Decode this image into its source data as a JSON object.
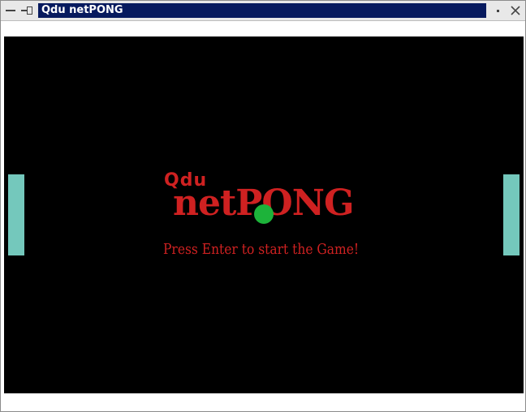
{
  "window": {
    "title": "Qdu netPONG"
  },
  "game": {
    "logo_small": "Qdu",
    "logo_big": "netPONG",
    "prompt": "Press Enter to start the Game!",
    "colors": {
      "background": "#000000",
      "paddle": "#74c8bc",
      "text": "#cf2121",
      "ball": "#1db33a"
    }
  }
}
